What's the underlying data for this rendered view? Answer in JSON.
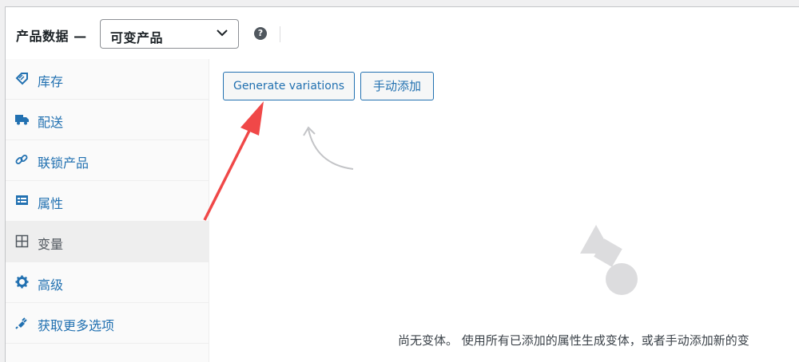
{
  "header": {
    "title": "产品数据 —",
    "product_type_value": "可变产品",
    "help_glyph": "?"
  },
  "sidebar": {
    "items": [
      {
        "label": "库存",
        "icon": "tag-icon"
      },
      {
        "label": "配送",
        "icon": "truck-icon"
      },
      {
        "label": "联锁产品",
        "icon": "link-icon"
      },
      {
        "label": "属性",
        "icon": "list-card-icon"
      },
      {
        "label": "变量",
        "icon": "grid-icon",
        "active": true
      },
      {
        "label": "高级",
        "icon": "gear-icon"
      },
      {
        "label": "获取更多选项",
        "icon": "plug-icon"
      }
    ]
  },
  "main": {
    "generate_label": "Generate variations",
    "manual_label": "手动添加",
    "empty_message": "尚无变体。 使用所有已添加的属性生成变体，或者手动添加新的变"
  },
  "colors": {
    "link": "#2271b1",
    "annotation_arrow": "#f04848",
    "hint_arrow": "#c3c4c7",
    "placeholder_shapes": "#dcdcde"
  }
}
